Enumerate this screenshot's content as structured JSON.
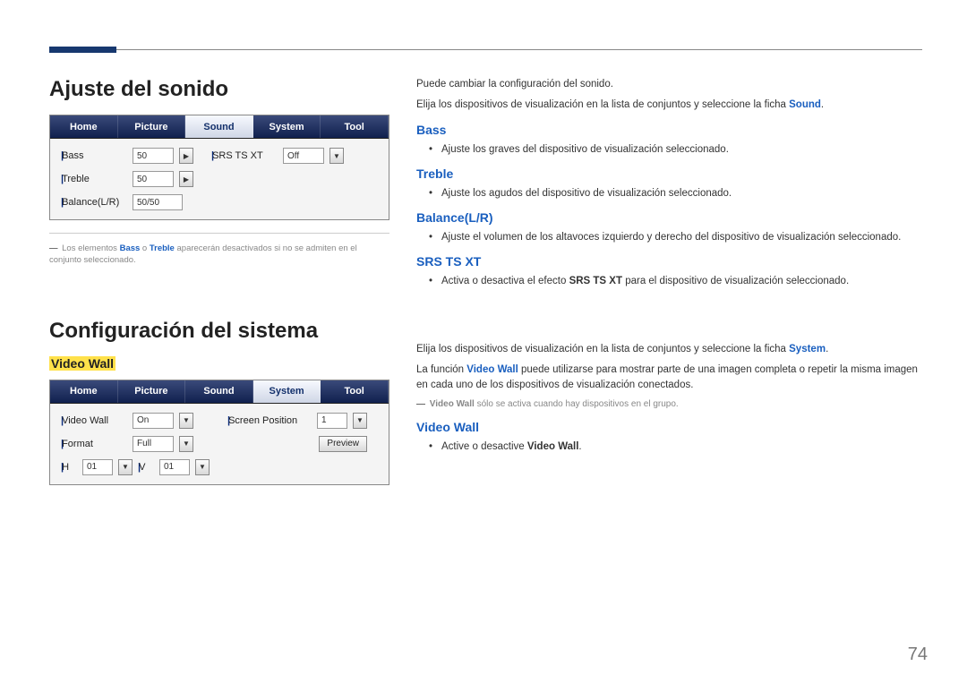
{
  "section1": {
    "heading": "Ajuste del sonido",
    "panel": {
      "tabs": [
        "Home",
        "Picture",
        "Sound",
        "System",
        "Tool"
      ],
      "active": 2,
      "rows_left": [
        {
          "label": "Bass",
          "value": "50"
        },
        {
          "label": "Treble",
          "value": "50"
        },
        {
          "label": "Balance(L/R)",
          "value": "50/50"
        }
      ],
      "rows_right": [
        {
          "label": "SRS TS XT",
          "value": "Off"
        }
      ]
    },
    "footnote_pre": "Los elementos ",
    "footnote_b1": "Bass",
    "footnote_mid1": " o ",
    "footnote_b2": "Treble",
    "footnote_post": " aparecerán desactivados si no se admiten en el conjunto seleccionado.",
    "right": {
      "intro1": "Puede cambiar la configuración del sonido.",
      "intro2_pre": "Elija los dispositivos de visualización en la lista de conjuntos y seleccione la ficha ",
      "intro2_bold": "Sound",
      "intro2_post": ".",
      "items": [
        {
          "title": "Bass",
          "bullet": "Ajuste los graves del dispositivo de visualización seleccionado."
        },
        {
          "title": "Treble",
          "bullet": "Ajuste los agudos del dispositivo de visualización seleccionado."
        },
        {
          "title": "Balance(L/R)",
          "bullet": "Ajuste el volumen de los altavoces izquierdo y derecho del dispositivo de visualización seleccionado."
        },
        {
          "title": "SRS TS XT",
          "bullet_pre": "Activa o desactiva el efecto ",
          "bullet_bold": "SRS TS XT",
          "bullet_post": " para el dispositivo de visualización seleccionado."
        }
      ]
    }
  },
  "section2": {
    "heading": "Configuración del sistema",
    "sub": "Video Wall",
    "panel": {
      "tabs": [
        "Home",
        "Picture",
        "Sound",
        "System",
        "Tool"
      ],
      "active": 3,
      "left": [
        {
          "label": "Video Wall",
          "value": "On"
        },
        {
          "label": "Format",
          "value": "Full"
        }
      ],
      "hv": {
        "hlabel": "H",
        "hval": "01",
        "vlabel": "V",
        "vval": "01"
      },
      "right": [
        {
          "label": "Screen Position",
          "value": "1"
        }
      ],
      "preview": "Preview"
    },
    "right": {
      "intro_pre": "Elija los dispositivos de visualización en la lista de conjuntos y seleccione la ficha ",
      "intro_bold": "System",
      "intro_post": ".",
      "para2_pre": "La función ",
      "para2_bold": "Video Wall",
      "para2_post": " puede utilizarse para mostrar parte de una imagen completa o repetir la misma imagen en cada uno de los dispositivos de visualización conectados.",
      "note_bold": "Video Wall",
      "note_post": " sólo se activa cuando hay dispositivos en el grupo.",
      "h": "Video Wall",
      "bullet_pre": "Active o desactive ",
      "bullet_bold": "Video Wall",
      "bullet_post": "."
    }
  },
  "page": "74"
}
